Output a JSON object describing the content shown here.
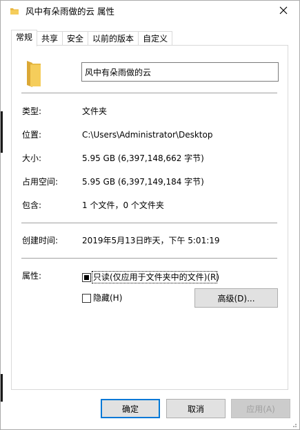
{
  "window": {
    "title": "风中有朵雨做的云 属性"
  },
  "tabs": [
    {
      "label": "常规",
      "active": true
    },
    {
      "label": "共享",
      "active": false
    },
    {
      "label": "安全",
      "active": false
    },
    {
      "label": "以前的版本",
      "active": false
    },
    {
      "label": "自定义",
      "active": false
    }
  ],
  "general": {
    "name_value": "风中有朵雨做的云",
    "type_label": "类型:",
    "type_value": "文件夹",
    "location_label": "位置:",
    "location_value": "C:\\Users\\Administrator\\Desktop",
    "size_label": "大小:",
    "size_value": "5.95 GB (6,397,148,662 字节)",
    "size_on_disk_label": "占用空间:",
    "size_on_disk_value": "5.95 GB (6,397,149,184 字节)",
    "contains_label": "包含:",
    "contains_value": "1 个文件，0 个文件夹",
    "created_label": "创建时间:",
    "created_value": "2019年5月13日昨天，下午 5:01:19",
    "attributes_label": "属性:",
    "readonly_label": "只读(仅应用于文件夹中的文件)(R)",
    "readonly_state": "indeterminate",
    "hidden_label": "隐藏(H)",
    "hidden_checked": false,
    "advanced_label": "高级(D)..."
  },
  "buttons": {
    "ok": "确定",
    "cancel": "取消",
    "apply": "应用(A)"
  },
  "icons": {
    "title": "folder-icon",
    "close": "close-icon",
    "folder_large": "folder-icon"
  },
  "colors": {
    "accent": "#0078d7",
    "folder": "#f0c24f"
  }
}
